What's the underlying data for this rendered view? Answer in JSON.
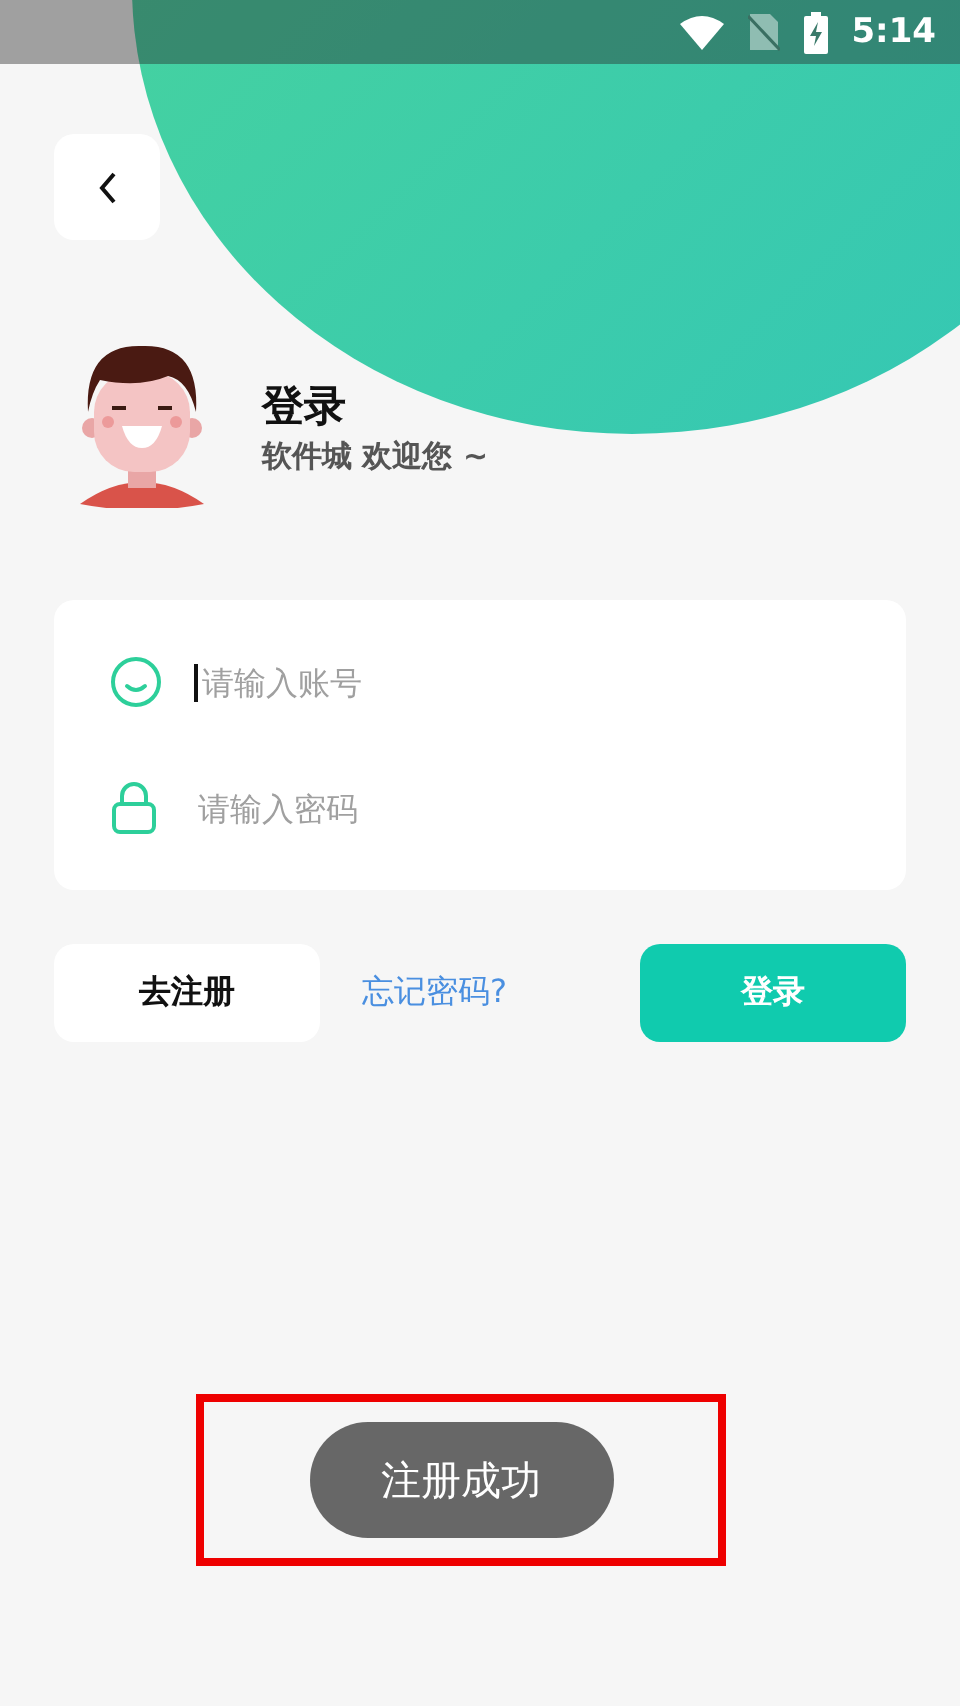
{
  "status_bar": {
    "time": "5:14"
  },
  "header": {
    "title": "登录",
    "subtitle": "软件城 欢迎您 ~"
  },
  "fields": [
    {
      "kind": "account",
      "placeholder": "请输入账号",
      "focused": true
    },
    {
      "kind": "password",
      "placeholder": "请输入密码",
      "focused": false
    }
  ],
  "actions": {
    "register": "去注册",
    "forgot": "忘记密码?",
    "login": "登录"
  },
  "toast": {
    "text": "注册成功",
    "highlighted": true
  }
}
